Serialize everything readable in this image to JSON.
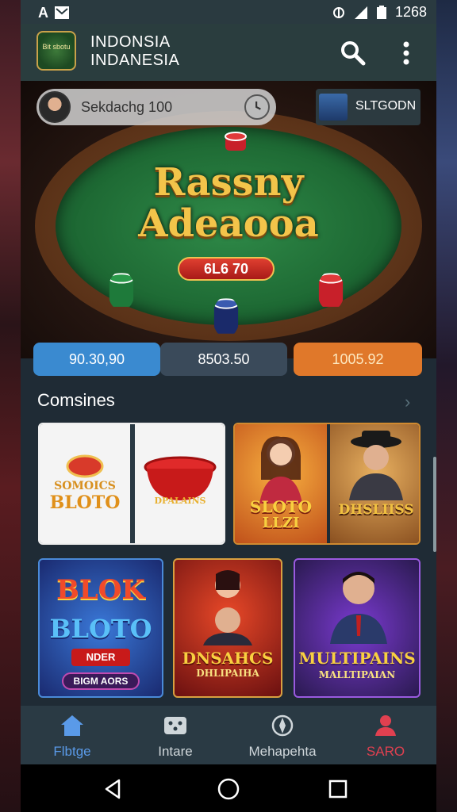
{
  "status_bar": {
    "left_icons": "A",
    "time": "1268"
  },
  "app": {
    "title_line1": "INDONSIA",
    "title_line2": "INDANESIA",
    "logo_text": "Bit sbotu"
  },
  "hero": {
    "user1_name": "Sekdachg 100",
    "user2_name": "SLTGODN",
    "title_line1": "Rassny",
    "title_line2": "Adeaooa",
    "jackpot": "6L6 70"
  },
  "stats": [
    "90.30,90",
    "8503.50",
    "1005.92"
  ],
  "section": {
    "title": "Comsines"
  },
  "games": [
    {
      "label1": "SOMOICS",
      "label2": "BLOTO"
    },
    {
      "label1": "DPALAINS"
    },
    {
      "label1": "SLOTO",
      "label2": "LLZI"
    },
    {
      "label1": "DHSLIISS"
    },
    {
      "label1": "BLOK",
      "label2": "BLOTO",
      "sub1": "NDER",
      "sub2": "BIGM AORS"
    },
    {
      "label1": "DNSAHCS",
      "label2": "DHLIPAIHA"
    },
    {
      "label1": "MULTIPAINS",
      "label2": "MALLTIPAIAN"
    }
  ],
  "bottom_nav": [
    {
      "label": "Flbtge",
      "icon": "home-icon",
      "active": true
    },
    {
      "label": "Intare",
      "icon": "dice-icon"
    },
    {
      "label": "Mehapehta",
      "icon": "compass-icon"
    },
    {
      "label": "SARO",
      "icon": "profile-icon"
    }
  ],
  "colors": {
    "accent_blue": "#3a8ad0",
    "accent_orange": "#e0782a",
    "felt_green": "#1e6a34",
    "gold": "#f3c44a",
    "profile_red": "#e04050"
  }
}
